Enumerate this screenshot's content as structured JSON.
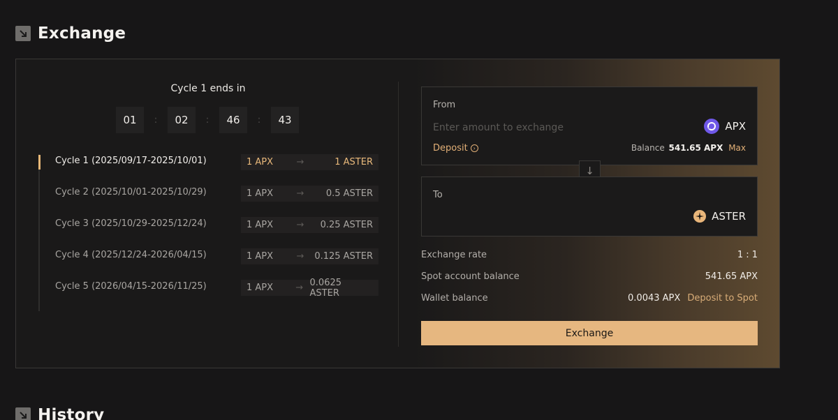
{
  "exchange_header": {
    "title": "Exchange",
    "icon": "arrow-down-right-icon"
  },
  "history_header": {
    "title": "History",
    "icon": "arrow-down-right-icon"
  },
  "countdown": {
    "title": "Cycle 1 ends in",
    "segments": [
      "01",
      "02",
      "46",
      "43"
    ],
    "separator": ":"
  },
  "cycles": [
    {
      "label": "Cycle 1 (2025/09/17-2025/10/01)",
      "from": "1 APX",
      "arrow": "→",
      "to": "1 ASTER",
      "active": true
    },
    {
      "label": "Cycle 2 (2025/10/01-2025/10/29)",
      "from": "1 APX",
      "arrow": "→",
      "to": "0.5 ASTER",
      "active": false
    },
    {
      "label": "Cycle 3 (2025/10/29-2025/12/24)",
      "from": "1 APX",
      "arrow": "→",
      "to": "0.25 ASTER",
      "active": false
    },
    {
      "label": "Cycle 4 (2025/12/24-2026/04/15)",
      "from": "1 APX",
      "arrow": "→",
      "to": "0.125 ASTER",
      "active": false
    },
    {
      "label": "Cycle 5 (2026/04/15-2026/11/25)",
      "from": "1 APX",
      "arrow": "→",
      "to": "0.0625 ASTER",
      "active": false
    }
  ],
  "from_box": {
    "label": "From",
    "placeholder": "Enter amount to exchange",
    "token": "APX",
    "deposit_label": "Deposit",
    "balance_label": "Balance",
    "balance_value": "541.65 APX",
    "max_label": "Max"
  },
  "swap_icon": "↓",
  "to_box": {
    "label": "To",
    "token": "ASTER"
  },
  "info": {
    "rate_label": "Exchange rate",
    "rate_value": "1 : 1",
    "spot_label": "Spot account balance",
    "spot_value": "541.65 APX",
    "wallet_label": "Wallet balance",
    "wallet_value": "0.0043 APX",
    "deposit_to_spot": "Deposit to Spot"
  },
  "exchange_button": "Exchange",
  "colors": {
    "accent": "#e6b780",
    "background": "#171617",
    "apx": "#6f58e8"
  }
}
